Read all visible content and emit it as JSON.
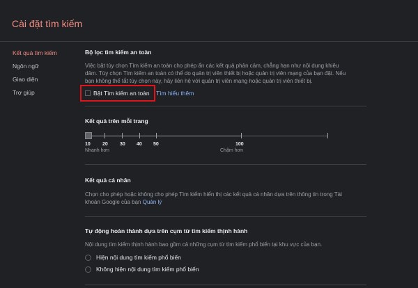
{
  "page_title": "Cài đặt tìm kiếm",
  "sidebar": {
    "items": [
      {
        "label": "Kết quả tìm kiếm",
        "active": true
      },
      {
        "label": "Ngôn ngữ",
        "active": false
      },
      {
        "label": "Giao diện",
        "active": false
      },
      {
        "label": "Trợ giúp",
        "active": false
      }
    ]
  },
  "safesearch": {
    "title": "Bộ lọc tìm kiếm an toàn",
    "description_lines": [
      "Việc bật tùy chọn Tìm kiếm an toàn cho phép ẩn các kết quả phản cảm, chẳng hạn như nội dung khiêu",
      "dâm. Tùy chọn Tìm kiếm an toàn có thể do quản trị viên thiết bị hoặc quản trị viên mạng của bạn đặt. Nếu",
      "bạn không thể tắt tùy chọn này, hãy liên hệ với quản trị viên mạng hoặc quản trị viên thiết bị."
    ],
    "checkbox_label": "Bật Tìm kiếm an toàn",
    "checked": false,
    "learn_more": "Tìm hiểu thêm"
  },
  "results_per_page": {
    "title": "Kết quả trên mỗi trang",
    "ticks": [
      "10",
      "20",
      "30",
      "40",
      "50",
      "100"
    ],
    "selected": "10",
    "left_label": "Nhanh hơn",
    "right_label": "Chậm hơn"
  },
  "private_results": {
    "title": "Kết quả cá nhân",
    "description_line1": "Chọn cho phép hoặc không cho phép Tìm kiếm hiển thị các kết quả cá nhân dựa trên thông tin trong Tài",
    "description_line2": "khoản Google của bạn ",
    "link": "Quản lý"
  },
  "autocomplete": {
    "title": "Tự động hoàn thành dựa trên cụm từ tìm kiếm thịnh hành",
    "description": "Nội dung tìm kiếm thịnh hành bao gồm cả những cụm từ tìm kiếm phổ biến tại khu vực của bạn.",
    "options": [
      {
        "label": "Hiện nội dung tìm kiếm phổ biến"
      },
      {
        "label": "Không hiện nội dung tìm kiếm phổ biến"
      }
    ]
  },
  "colors": {
    "accent": "#f28b82",
    "link": "#8ab4f8",
    "highlight": "#e0151b",
    "background": "#202124"
  }
}
